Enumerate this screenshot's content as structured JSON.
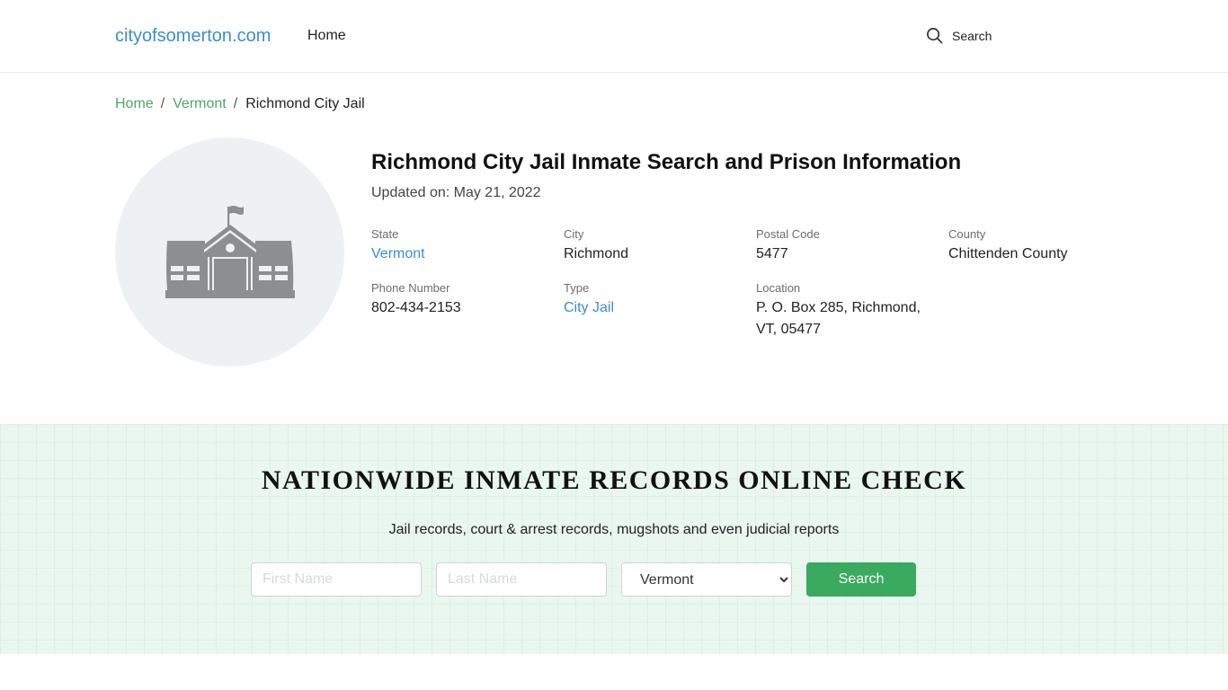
{
  "header": {
    "logo": "cityofsomerton.com",
    "nav": [
      {
        "label": "Home"
      }
    ],
    "search_label": "Search"
  },
  "breadcrumb": [
    {
      "label": "Home",
      "link": true
    },
    {
      "label": "Vermont",
      "link": true
    },
    {
      "label": "Richmond City Jail",
      "link": false
    }
  ],
  "facility": {
    "icon": "school-building-icon",
    "title": "Richmond City Jail Inmate Search and Prison Information",
    "updated": "Updated on: May 21, 2022",
    "fields": [
      {
        "label": "State",
        "value": "Vermont",
        "link": true
      },
      {
        "label": "City",
        "value": "Richmond",
        "link": false
      },
      {
        "label": "Postal Code",
        "value": "5477",
        "link": false
      },
      {
        "label": "County",
        "value": "Chittenden County",
        "link": false
      },
      {
        "label": "Phone Number",
        "value": "802-434-2153",
        "link": false
      },
      {
        "label": "Type",
        "value": "City Jail",
        "link": true
      },
      {
        "label": "Location",
        "value": "P. O. Box 285, Richmond, VT, 05477",
        "link": false
      }
    ]
  },
  "search_banner": {
    "title": "NATIONWIDE INMATE RECORDS ONLINE CHECK",
    "subtitle": "Jail records, court & arrest records, mugshots and even judicial reports",
    "first_name_placeholder": "First Name",
    "last_name_placeholder": "Last Name",
    "state_selected": "Vermont",
    "button_label": "Search"
  },
  "colors": {
    "link_blue": "#3d8fc6",
    "breadcrumb_green": "#4ca66a",
    "button_green": "#3aaa5e",
    "banner_bg": "#eaf7ef"
  }
}
